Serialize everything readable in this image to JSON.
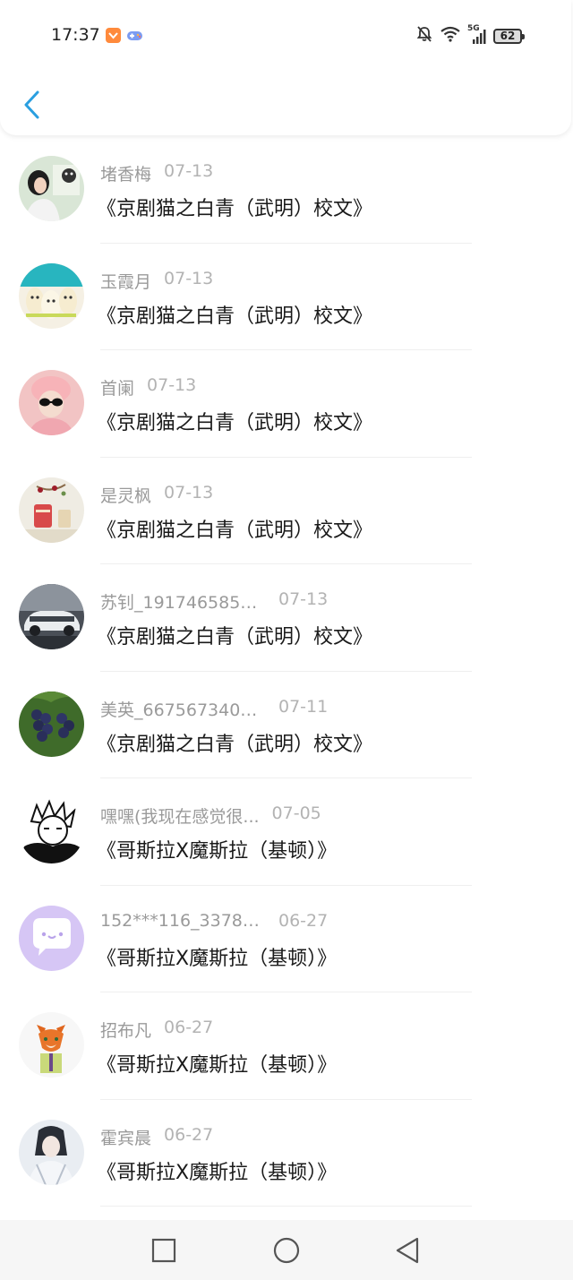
{
  "status_bar": {
    "time": "17:37",
    "network": "5G",
    "battery": "62"
  },
  "items": [
    {
      "name": "堵香梅",
      "date": "07-13",
      "title": "《京剧猫之白青（武明）校文》"
    },
    {
      "name": "玉霞月",
      "date": "07-13",
      "title": "《京剧猫之白青（武明）校文》"
    },
    {
      "name": "首阑",
      "date": "07-13",
      "title": "《京剧猫之白青（武明）校文》"
    },
    {
      "name": "是灵枫",
      "date": "07-13",
      "title": "《京剧猫之白青（武明）校文》"
    },
    {
      "name": "苏钊_1917465851...",
      "date": "07-13",
      "title": "《京剧猫之白青（武明）校文》"
    },
    {
      "name": "美英_6675673401...",
      "date": "07-11",
      "title": "《京剧猫之白青（武明）校文》"
    },
    {
      "name": "嘿嘿(我现在感觉很...",
      "date": "07-05",
      "title": "《哥斯拉X魔斯拉（基顿）》"
    },
    {
      "name": "152***116_33786...",
      "date": "06-27",
      "title": "《哥斯拉X魔斯拉（基顿）》"
    },
    {
      "name": "招布凡",
      "date": "06-27",
      "title": "《哥斯拉X魔斯拉（基顿）》"
    },
    {
      "name": "霍宾晨",
      "date": "06-27",
      "title": "《哥斯拉X魔斯拉（基顿）》"
    }
  ],
  "colors": {
    "accent": "#2a9fe0",
    "name_text": "#9a9a9a",
    "title_text": "#1a1a1a"
  }
}
